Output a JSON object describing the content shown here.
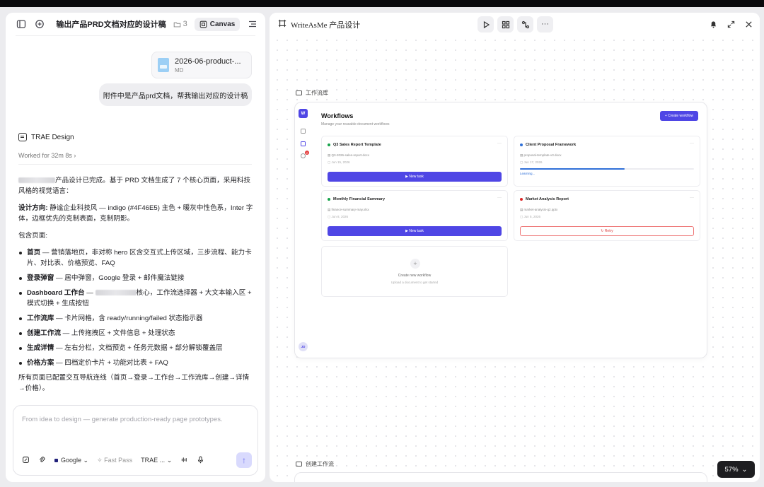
{
  "left_panel": {
    "chat_title": "输出产品PRD文档对应的设计稿",
    "folder_count": "3",
    "canvas_label": "Canvas",
    "attachment": {
      "name": "2026-06-product-...",
      "type": "MD"
    },
    "user_message": "附件中是产品prd文档，帮我输出对应的设计稿",
    "agent_name": "TRAE Design",
    "worked_for": "Worked for 32m 8s",
    "response": {
      "intro_text": "产品设计已完成。基于 PRD 文档生成了 7 个核心页面，采用科技风格的视觉语言：",
      "direction_label": "设计方向:",
      "direction_text": " 静谧企业科技风 — indigo (#4F46E5) 主色 + 暖灰中性色系，Inter 字体，边框优先的克制表面，克制阴影。",
      "pages_heading": "包含页面:",
      "items": [
        {
          "name": "首页",
          "desc": " — 营销落地页，非对称 hero 区含交互式上传区域，三步流程、能力卡片、对比表、价格预览、FAQ"
        },
        {
          "name": "登录弹窗",
          "desc": " — 居中弹窗，Google 登录 + 邮件魔法链接"
        },
        {
          "name": "Dashboard 工作台",
          "desc": " — ",
          "desc_after_blur": "核心，工作流选择器 + 大文本输入区 + 模式切换 + 生成按钮"
        },
        {
          "name": "工作流库",
          "desc": " — 卡片网格，含 ready/running/failed 状态指示器"
        },
        {
          "name": "创建工作流",
          "desc": " — 上传拖拽区 + 文件信息 + 处理状态"
        },
        {
          "name": "生成详情",
          "desc": " — 左右分栏，文档预览 + 任务元数据 + 部分解锁覆盖层"
        },
        {
          "name": "价格方案",
          "desc": " — 四档定价卡片 + 功能对比表 + FAQ"
        }
      ],
      "outro": "所有页面已配置交互导航连线（首页→登录→工作台→工作流库→创建→详情→价格）。"
    },
    "composer": {
      "placeholder": "From idea to design — generate production-ready page prototypes.",
      "model": "Google",
      "mode": "Fast Pass",
      "agent": "TRAE ..."
    }
  },
  "right_panel": {
    "title": "WriteAsMe 产品设计",
    "zoom": "57%",
    "frames": [
      {
        "label": "工作流库"
      },
      {
        "label": "创建工作流"
      }
    ],
    "workflows_page": {
      "logo_letter": "W",
      "title": "Workflows",
      "subtitle": "Manage your reusable document workflows",
      "new_button": "+  Create workflow",
      "avatar": "JD",
      "badge": "2",
      "cards": [
        {
          "title": "Q3 Sales Report Template",
          "status_color": "#16a34a",
          "file": "Q3-2026-sales-report.docx",
          "date": "Jun 15, 2026",
          "action": "▶  New task",
          "state": "ready"
        },
        {
          "title": "Client Proposal Framework",
          "status_color": "#2f6fd8",
          "file": "proposal-template-v3.docx",
          "date": "Jun 17, 2026",
          "progress": 0.6,
          "progress_label": "Learning...",
          "state": "running"
        },
        {
          "title": "Monthly Financial Summary",
          "status_color": "#16a34a",
          "file": "finance-summary-may.xlsx",
          "date": "Jun 8, 2026",
          "action": "▶  New task",
          "state": "ready"
        },
        {
          "title": "Market Analysis Report",
          "status_color": "#dc2626",
          "file": "market-analysis-q2.pptx",
          "date": "Jun 5, 2026",
          "action": "↻  Retry",
          "state": "failed"
        }
      ],
      "create_card": {
        "title": "Create new workflow",
        "subtitle": "Upload a document to get started"
      }
    }
  }
}
